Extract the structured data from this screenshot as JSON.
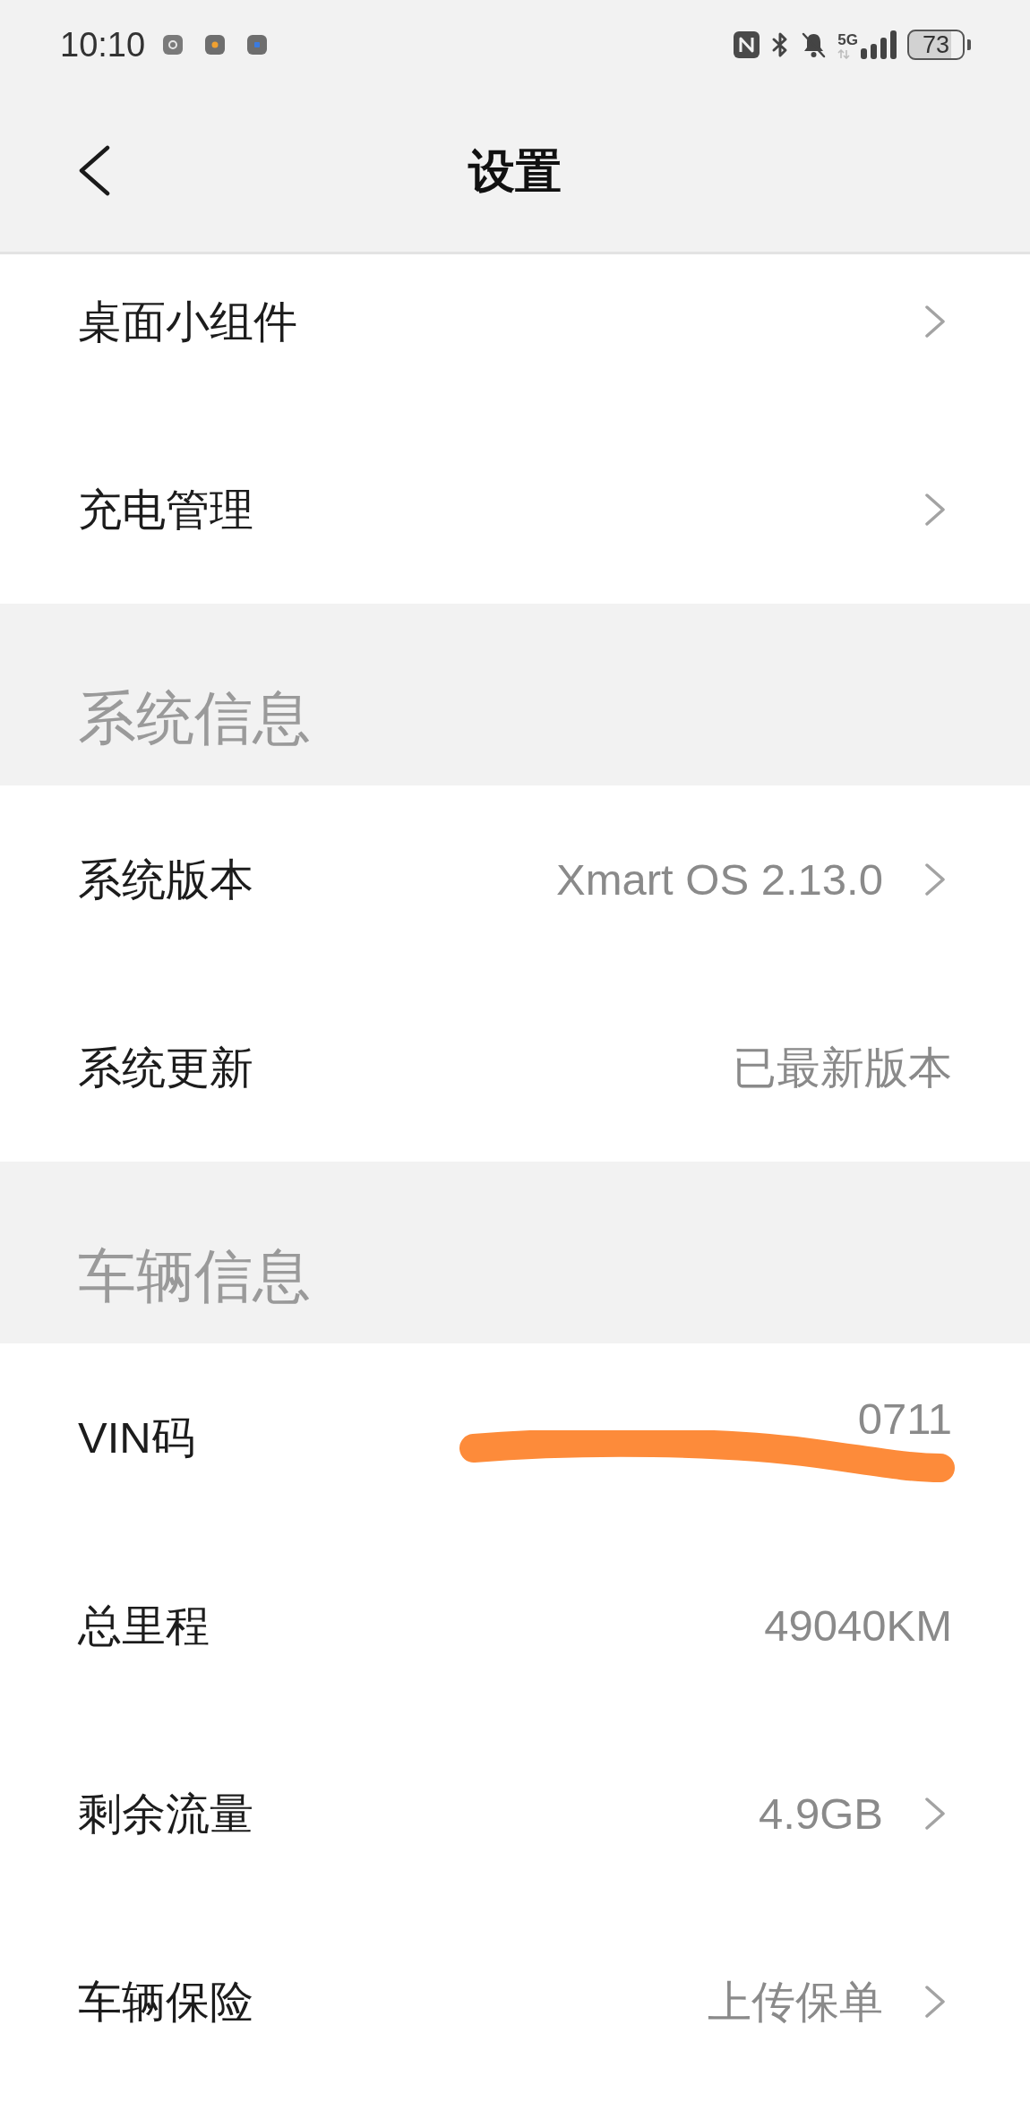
{
  "status_bar": {
    "time": "10:10",
    "network": "5G",
    "battery": "73"
  },
  "header": {
    "title": "设置"
  },
  "items": [
    {
      "kind": "row",
      "label": "桌面小组件",
      "chevron": true
    },
    {
      "kind": "row",
      "label": "充电管理",
      "chevron": true
    },
    {
      "kind": "section",
      "title": "系统信息"
    },
    {
      "kind": "row",
      "label": "系统版本",
      "value": "Xmart OS 2.13.0",
      "chevron": true
    },
    {
      "kind": "row",
      "label": "系统更新",
      "value": "已最新版本",
      "chevron": false
    },
    {
      "kind": "section",
      "title": "车辆信息"
    },
    {
      "kind": "row",
      "label": "VIN码",
      "value": "0711",
      "chevron": false,
      "redacted": true
    },
    {
      "kind": "row",
      "label": "总里程",
      "value": "49040KM",
      "chevron": false
    },
    {
      "kind": "row",
      "label": "剩余流量",
      "value": "4.9GB",
      "chevron": true
    },
    {
      "kind": "row",
      "label": "车辆保险",
      "value": "上传保单",
      "chevron": true
    }
  ]
}
